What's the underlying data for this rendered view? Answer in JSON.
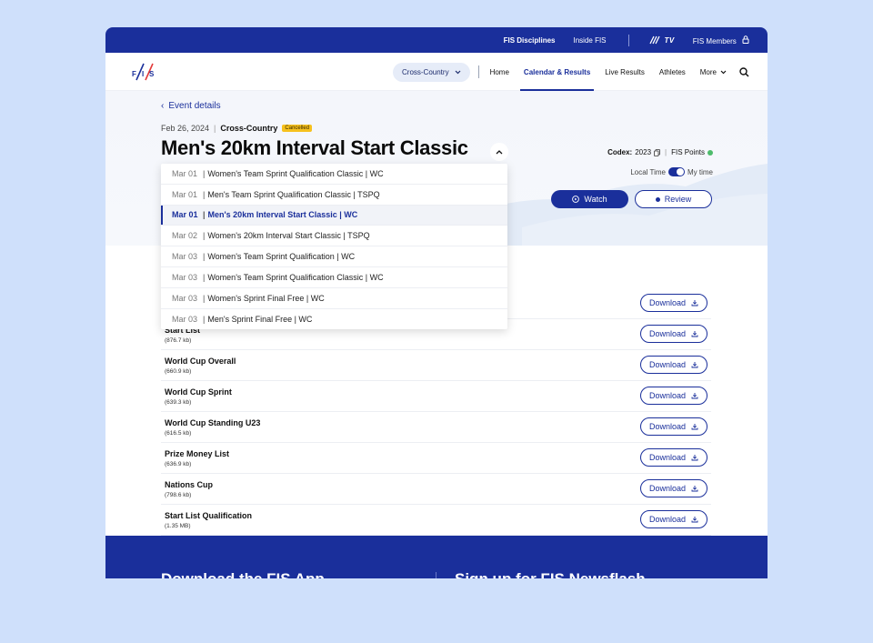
{
  "topbar": {
    "disciplines": "FIS Disciplines",
    "inside": "Inside FIS",
    "tv": "TV",
    "members": "FIS Members"
  },
  "nav": {
    "discipline_select": "Cross-Country",
    "links": [
      "Home",
      "Calendar & Results",
      "Live Results",
      "Athletes"
    ],
    "active": "Calendar & Results",
    "more": "More"
  },
  "event": {
    "back": "Event details",
    "date": "Feb 26, 2024",
    "discipline": "Cross-Country",
    "status": "Cancelled",
    "title": "Men's 20km Interval Start Classic",
    "codex_label": "Codex:",
    "codex_value": "2023",
    "fis_points": "FIS Points",
    "local_time": "Local Time",
    "my_time": "My time",
    "watch": "Watch",
    "review": "Review"
  },
  "dropdown": [
    {
      "date": "Mar 01",
      "name": "Women's Team Sprint Qualification Classic | WC",
      "active": false
    },
    {
      "date": "Mar 01",
      "name": "Men's Team Sprint Qualification Classic | TSPQ",
      "active": false
    },
    {
      "date": "Mar 01",
      "name": "Men's 20km Interval Start Classic | WC",
      "active": true
    },
    {
      "date": "Mar 02",
      "name": "Women's 20km Interval Start Classic | TSPQ",
      "active": false
    },
    {
      "date": "Mar 03",
      "name": "Women's Team Sprint Qualification | WC",
      "active": false
    },
    {
      "date": "Mar 03",
      "name": "Women's Team Sprint Qualification Classic | WC",
      "active": false
    },
    {
      "date": "Mar 03",
      "name": "Women's Sprint Final Free | WC",
      "active": false
    },
    {
      "date": "Mar 03",
      "name": "Men's Sprint Final Free | WC",
      "active": false
    }
  ],
  "documents": {
    "download_label": "Download",
    "items": [
      {
        "name": "",
        "size": ""
      },
      {
        "name": "Start List",
        "size": "(876.7 kb)"
      },
      {
        "name": "World Cup Overall",
        "size": "(660.9 kb)"
      },
      {
        "name": "World Cup Sprint",
        "size": "(639.3 kb)"
      },
      {
        "name": "World Cup Standing U23",
        "size": "(616.5 kb)"
      },
      {
        "name": "Prize Money List",
        "size": "(636.9 kb)"
      },
      {
        "name": "Nations Cup",
        "size": "(798.6 kb)"
      },
      {
        "name": "Start List Qualification",
        "size": "(1.35 MB)"
      }
    ]
  },
  "footer": {
    "app": "Download the FIS App",
    "news": "Sign up for FIS Newsflash"
  },
  "colors": {
    "brand_blue": "#1a2f9b",
    "badge_yellow": "#f6c11d",
    "status_green": "#4dbb6b",
    "page_bg": "#cfe0fb"
  }
}
